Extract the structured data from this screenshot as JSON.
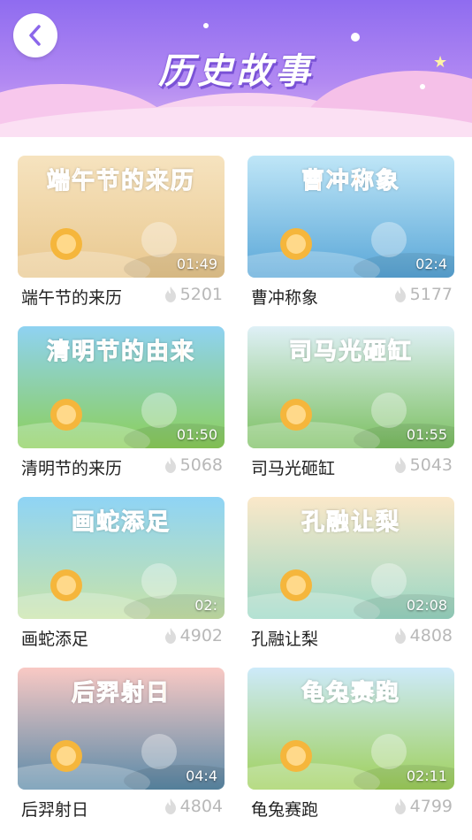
{
  "header": {
    "title": "历史故事"
  },
  "stories": [
    {
      "thumb_title": "端午节的来历",
      "duration": "01:49",
      "name": "端午节的来历",
      "views": "5201",
      "bg_top": "#f6e3bf",
      "bg_bottom": "#e9c88f",
      "title_color": "#f08a1e"
    },
    {
      "thumb_title": "曹冲称象",
      "duration": "02:4",
      "name": "曹冲称象",
      "views": "5177",
      "bg_top": "#bfe6f7",
      "bg_bottom": "#5aa7d8",
      "title_color": "#f07a18"
    },
    {
      "thumb_title": "清明节的由来",
      "duration": "01:50",
      "name": "清明节的来历",
      "views": "5068",
      "bg_top": "#8fd2f2",
      "bg_bottom": "#8ccf5a",
      "title_color": "#f0b418"
    },
    {
      "thumb_title": "司马光砸缸",
      "duration": "01:55",
      "name": "司马光砸缸",
      "views": "5043",
      "bg_top": "#dff0f7",
      "bg_bottom": "#7cc061",
      "title_color": "#ffffff"
    },
    {
      "thumb_title": "画蛇添足",
      "duration": "02:",
      "name": "画蛇添足",
      "views": "4902",
      "bg_top": "#8fd4f5",
      "bg_bottom": "#c8e3a8",
      "title_color": "#ffffff"
    },
    {
      "thumb_title": "孔融让梨",
      "duration": "02:08",
      "name": "孔融让梨",
      "views": "4808",
      "bg_top": "#fbe8c9",
      "bg_bottom": "#9ad7c4",
      "title_color": "#ffffff"
    },
    {
      "thumb_title": "后羿射日",
      "duration": "04:4",
      "name": "后羿射日",
      "views": "4804",
      "bg_top": "#f9c9c4",
      "bg_bottom": "#5b8aa8",
      "title_color": "#ff9b2a"
    },
    {
      "thumb_title": "龟兔赛跑",
      "duration": "02:11",
      "name": "龟兔赛跑",
      "views": "4799",
      "bg_top": "#cdeafa",
      "bg_bottom": "#9fd05b",
      "title_color": "#ffffff"
    }
  ]
}
